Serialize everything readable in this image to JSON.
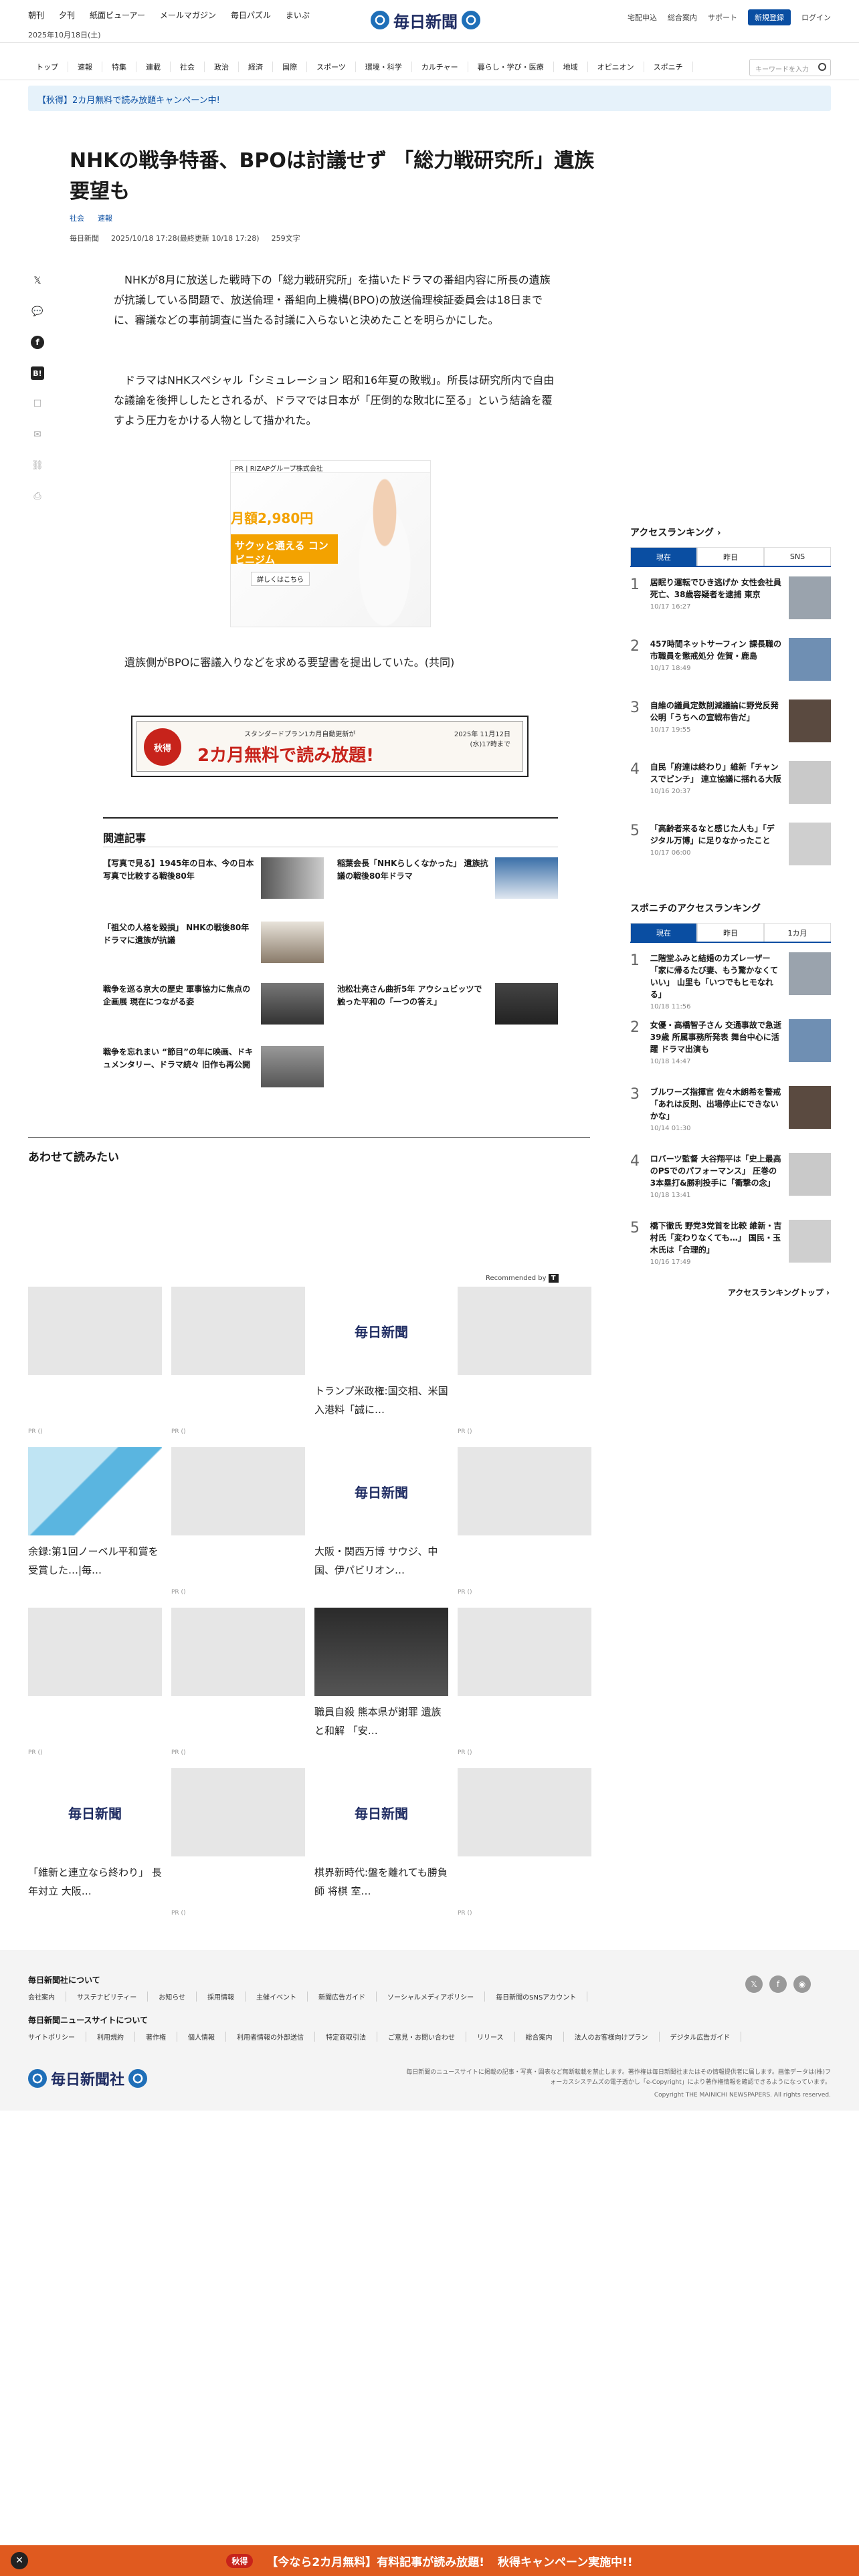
{
  "header": {
    "top_links": [
      "朝刊",
      "夕刊",
      "紙面ビューアー",
      "メールマガジン",
      "毎日パズル",
      "まいぷ"
    ],
    "date": "2025年10月18日(土)",
    "logo_text": "毎日新聞",
    "right_links": [
      "宅配申込",
      "総合案内",
      "サポート"
    ],
    "register_label": "新規登録",
    "login_label": "ログイン"
  },
  "nav": {
    "items": [
      "トップ",
      "速報",
      "特集",
      "連載",
      "社会",
      "政治",
      "経済",
      "国際",
      "スポーツ",
      "環境・科学",
      "カルチャー",
      "暮らし・学び・医療",
      "地域",
      "オピニオン",
      "スポニチ"
    ],
    "search_placeholder": "キーワードを入力"
  },
  "campaign_text": "【秋得】2カ月無料で読み放題キャンペーン中!",
  "article": {
    "title": "NHKの戦争特番、BPOは討議せず 「総力戦研究所」遺族要望も",
    "tags": [
      "社会",
      "速報"
    ],
    "source": "毎日新聞",
    "datetime": "2025/10/18 17:28(最終更新 10/18 17:28)",
    "chars": "259文字",
    "paragraphs": [
      "NHKが8月に放送した戦時下の「総力戦研究所」を描いたドラマの番組内容に所長の遺族が抗議している問題で、放送倫理・番組向上機構(BPO)の放送倫理検証委員会は18日までに、審議などの事前調査に当たる討議に入らないと決めたことを明らかにした。",
      "ドラマはNHKスペシャル「シミュレーション 昭和16年夏の敗戦」。所長は研究所内で自由な議論を後押ししたとされるが、ドラマでは日本が「圧倒的な敗北に至る」という結論を覆すよう圧力をかける人物として描かれた。",
      "遺族側がBPOに審議入りなどを求める要望書を提出していた。(共同)"
    ]
  },
  "ad": {
    "label": "PR | RIZAPグループ株式会社",
    "price": "月額2,980円",
    "copy": "サクッと通える コンビニジム",
    "cta": "詳しくはこちら"
  },
  "banner": {
    "badge": "秋得",
    "sub": "スタンダードプラン1カ月自動更新が",
    "main": "2カ月無料で読み放題!",
    "date": "2025年 11月12日(水)17時まで"
  },
  "related": {
    "heading": "関連記事",
    "items": [
      "【写真で見る】1945年の日本、今の日本 写真で比較する戦後80年",
      "稲葉会長「NHKらしくなかった」 遺族抗議の戦後80年ドラマ",
      "「祖父の人格を毀損」 NHKの戦後80年ドラマに遺族が抗議",
      "",
      "戦争を巡る京大の歴史 軍事協力に焦点の企画展 現在につながる姿",
      "池松壮亮さん曲折5年 アウシュビッツで触った平和の「一つの答え」",
      "戦争を忘れまい “節目”の年に映画、ドキュメンタリー、ドラマ続々 旧作も再公開"
    ]
  },
  "recommend": {
    "heading": "あわせて読みたい",
    "by": "Recommended by",
    "cards": [
      {
        "title": "",
        "pr": "PR ()"
      },
      {
        "title": "",
        "pr": "PR ()"
      },
      {
        "title": "トランプ米政権:国交相、米国入港料「誠に…",
        "pr": ""
      },
      {
        "title": "",
        "pr": "PR ()"
      },
      {
        "title": "余録:第1回ノーベル平和賞を受賞した…|毎…",
        "pr": ""
      },
      {
        "title": "",
        "pr": "PR ()"
      },
      {
        "title": "大阪・関西万博 サウジ、中国、伊パビリオン…",
        "pr": ""
      },
      {
        "title": "",
        "pr": "PR ()"
      },
      {
        "title": "",
        "pr": "PR ()"
      },
      {
        "title": "",
        "pr": "PR ()"
      },
      {
        "title": "職員自殺 熊本県が謝罪 遺族と和解 「安…",
        "pr": ""
      },
      {
        "title": "",
        "pr": "PR ()"
      },
      {
        "title": "「維新と連立なら終わり」 長年対立 大阪…",
        "pr": ""
      },
      {
        "title": "",
        "pr": "PR ()"
      },
      {
        "title": "棋界新時代:盤を離れても勝負師 将棋 室…",
        "pr": ""
      },
      {
        "title": "",
        "pr": "PR ()"
      }
    ]
  },
  "ranking": {
    "heading": "アクセスランキング",
    "tabs": [
      "現在",
      "昨日",
      "SNS"
    ],
    "items": [
      {
        "title": "居眠り運転でひき逃げか 女性会社員死亡、38歳容疑者を逮捕 東京",
        "date": "10/17 16:27"
      },
      {
        "title": "457時間ネットサーフィン 課長職の市職員を懲戒処分 佐賀・鹿島",
        "date": "10/17 18:49"
      },
      {
        "title": "自維の議員定数削減議論に野党反発 公明「うちへの宣戦布告だ」",
        "date": "10/17 19:55"
      },
      {
        "title": "自民「府連は終わり」維新「チャンスでピンチ」 連立協議に揺れる大阪",
        "date": "10/16 20:37"
      },
      {
        "title": "「高齢者来るなと感じた人も」「デジタル万博」に足りなかったこと",
        "date": "10/17 06:00"
      }
    ]
  },
  "sponichi": {
    "heading": "スポニチのアクセスランキング",
    "tabs": [
      "現在",
      "昨日",
      "1カ月"
    ],
    "items": [
      {
        "title": "二階堂ふみと結婚のカズレーザー「家に帰るたび妻、もう驚かなくていい」 山里も「いつでもヒモなれる」",
        "date": "10/18 11:56"
      },
      {
        "title": "女優・高橋智子さん 交通事故で急逝 39歳 所属事務所発表 舞台中心に活躍 ドラマ出演も",
        "date": "10/18 14:47"
      },
      {
        "title": "ブルワーズ指揮官 佐々木朗希を警戒「あれは反則、出場停止にできないかな」",
        "date": "10/14 01:30"
      },
      {
        "title": "ロバーツ監督 大谷翔平は「史上最高のPSでのパフォーマンス」 圧巻の3本塁打&勝利投手に「衝撃の念」",
        "date": "10/18 13:41"
      },
      {
        "title": "橋下徹氏 野党3党首を比較 維新・吉村氏「変わりなくても…」 国民・玉木氏は「合理的」",
        "date": "10/16 17:49"
      }
    ],
    "more": "アクセスランキングトップ"
  },
  "footer": {
    "about_heading": "毎日新聞社について",
    "about_links": [
      "会社案内",
      "サステナビリティー",
      "お知らせ",
      "採用情報",
      "主催イベント",
      "新聞広告ガイド",
      "ソーシャルメディアポリシー",
      "毎日新聞のSNSアカウント"
    ],
    "site_heading": "毎日新聞ニュースサイトについて",
    "site_links": [
      "サイトポリシー",
      "利用規約",
      "著作権",
      "個人情報",
      "利用者情報の外部送信",
      "特定商取引法",
      "ご意見・お問い合わせ",
      "リリース",
      "総合案内",
      "法人のお客様向けプラン",
      "デジタル広告ガイド"
    ],
    "logo_text": "毎日新聞社",
    "note": "毎日新聞のニュースサイトに掲載の記事・写真・図表など無断転載を禁止します。著作権は毎日新聞社またはその情報提供者に属します。画像データは(株)フォーカスシステムズの電子透かし「e-Copyright」により著作権情報を確認できるようになっています。",
    "copyright": "Copyright THE MAINICHI NEWSPAPERS. All rights reserved."
  },
  "bottom_bar": {
    "tag": "秋得",
    "text": "【今なら2カ月無料】有料記事が読み放題!",
    "cta": "秋得キャンペーン実施中!!"
  }
}
